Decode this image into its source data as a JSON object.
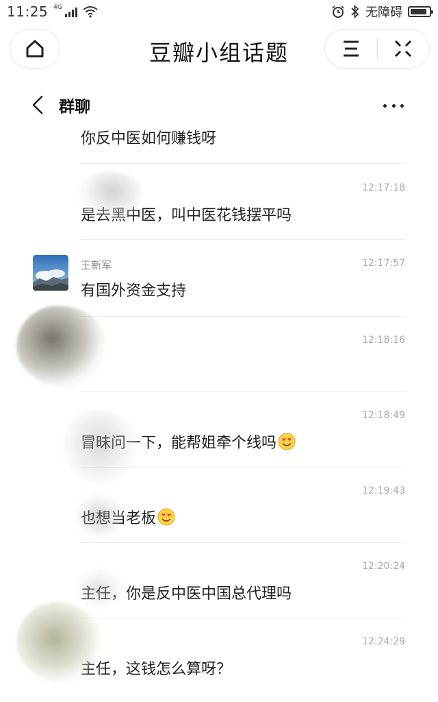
{
  "status_bar": {
    "time": "11:25",
    "network": "4G",
    "accessibility": "无障碍",
    "icons": [
      "signal-icon",
      "wifi-icon",
      "alarm-icon",
      "bluetooth-icon",
      "battery-icon"
    ],
    "battery_level": 0.9
  },
  "title_bar": {
    "title": "豆瓣小组话题",
    "home_icon": "home-icon",
    "menu_icon": "menu-icon",
    "close_icon": "close-icon"
  },
  "chat_header": {
    "title": "群聊",
    "back_icon": "chevron-left-icon",
    "more_icon": "more-icon"
  },
  "messages": [
    {
      "sender": "",
      "time": "",
      "text": "你反中医如何赚钱呀",
      "emoji": false
    },
    {
      "sender": "",
      "time": "12:17:18",
      "text": "是去黑中医，叫中医花钱摆平吗",
      "emoji": false
    },
    {
      "sender": "王新军",
      "time": "12:17:57",
      "text": "有国外资金支持",
      "emoji": false
    },
    {
      "sender": "",
      "time": "12:18:16",
      "text": "",
      "emoji": false
    },
    {
      "sender": "",
      "time": "12:18:49",
      "text": "冒昧问一下，能帮姐牵个线吗",
      "emoji": true
    },
    {
      "sender": "",
      "time": "12:19:43",
      "text": "也想当老板",
      "emoji": true
    },
    {
      "sender": "",
      "time": "12:20:24",
      "text": "主任，你是反中医中国总代理吗",
      "emoji": false
    },
    {
      "sender": "",
      "time": "12:24:29",
      "text": "主任，这钱怎么算呀？",
      "emoji": false
    }
  ],
  "colors": {
    "text": "#222222",
    "meta": "#a8a8a8",
    "divider": "#ececec"
  }
}
